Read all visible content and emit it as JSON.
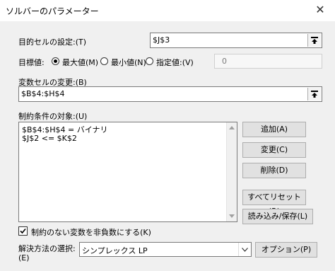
{
  "window": {
    "title": "ソルバーのパラメーター",
    "close_glyph": "✕"
  },
  "objective": {
    "label": "目的セルの設定:(T)",
    "value": "$J$3"
  },
  "target": {
    "label": "目標値:",
    "options": [
      {
        "label": "最大値(M)",
        "selected": true
      },
      {
        "label": "最小値(N)",
        "selected": false
      },
      {
        "label": "指定値:(V)",
        "selected": false
      }
    ],
    "value_field": "0"
  },
  "variable_cells": {
    "label": "変数セルの変更:(B)",
    "value": "$B$4:$H$4"
  },
  "constraints": {
    "label": "制約条件の対象:(U)",
    "items": [
      "$B$4:$H$4 = バイナリ",
      "$J$2 <= $K$2"
    ]
  },
  "buttons": {
    "add": "追加(A)",
    "change": "変更(C)",
    "delete": "削除(D)",
    "reset_all": "すべてリセット(R)",
    "load_save": "読み込み/保存(L)",
    "options": "オプション(P)"
  },
  "nonnegative": {
    "label": "制約のない変数を非負数にする(K)",
    "checked": true
  },
  "method": {
    "label_line1": "解決方法の選択:",
    "label_line2": "(E)",
    "selected": "シンプレックス LP"
  }
}
